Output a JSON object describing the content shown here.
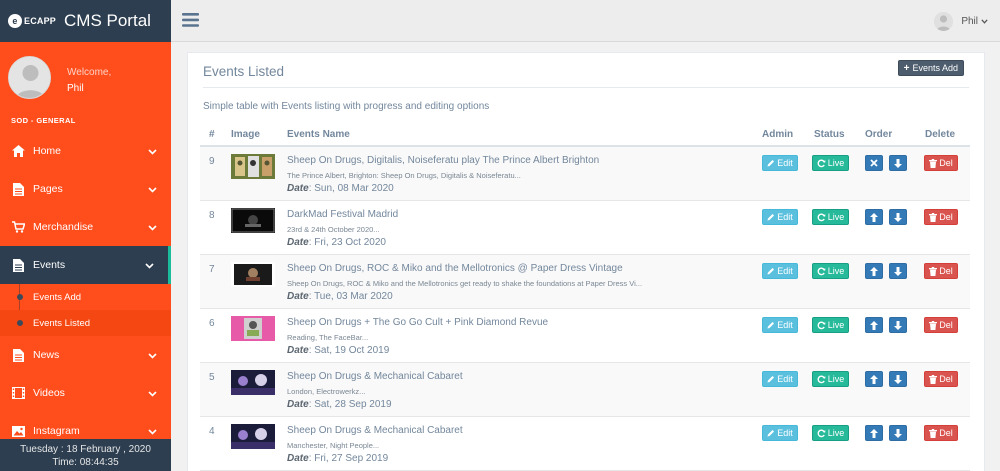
{
  "brand": {
    "logo_text": "ECAPP",
    "logo_letter": "e",
    "title": "CMS Portal"
  },
  "profile": {
    "welcome": "Welcome,",
    "name": "Phil"
  },
  "sidebar": {
    "section_label": "SOD - GENERAL",
    "items": [
      {
        "label": "Home",
        "icon": "home-icon"
      },
      {
        "label": "Pages",
        "icon": "file-icon"
      },
      {
        "label": "Merchandise",
        "icon": "cart-icon"
      },
      {
        "label": "Events",
        "icon": "file-icon",
        "active": true
      },
      {
        "label": "News",
        "icon": "file-icon"
      },
      {
        "label": "Videos",
        "icon": "film-icon"
      },
      {
        "label": "Instagram",
        "icon": "image-icon"
      }
    ],
    "events_submenu": [
      {
        "label": "Events Add"
      },
      {
        "label": "Events Listed",
        "selected": true
      }
    ]
  },
  "footer": {
    "date_line": "Tuesday : 18 February , 2020",
    "time_line": "Time: 08:44:35"
  },
  "topbar": {
    "user_name": "Phil"
  },
  "panel": {
    "title": "Events Listed",
    "add_button": "Events Add",
    "description": "Simple table with Events listing with progress and editing options"
  },
  "table": {
    "headers": {
      "num": "#",
      "image": "Image",
      "name": "Events Name",
      "admin": "Admin",
      "status": "Status",
      "order": "Order",
      "delete": "Delete"
    },
    "actions": {
      "edit": "Edit",
      "live": "Live",
      "del": "Del",
      "date_label": "Date"
    },
    "rows": [
      {
        "num": "9",
        "name": "Sheep On Drugs, Digitalis, Noiseferatu play The Prince Albert Brighton",
        "desc": "The Prince Albert, Brighton: Sheep On Drugs, Digitalis & Noiseferatu...",
        "date": ": Sun, 08 Mar 2020",
        "first": true
      },
      {
        "num": "8",
        "name": "DarkMad Festival Madrid",
        "desc": "23rd & 24th October 2020...",
        "date": ": Fri, 23 Oct 2020"
      },
      {
        "num": "7",
        "name": "Sheep On Drugs, ROC & Miko and the Mellotronics @ Paper Dress Vintage",
        "desc": "Sheep On Drugs, ROC & Miko and the Mellotronics get ready to shake the foundations at Paper Dress Vi...",
        "date": ": Tue, 03 Mar 2020"
      },
      {
        "num": "6",
        "name": "Sheep On Drugs + The Go Go Cult + Pink Diamond Revue",
        "desc": "Reading, The FaceBar...",
        "date": ": Sat, 19 Oct 2019"
      },
      {
        "num": "5",
        "name": "Sheep On Drugs & Mechanical Cabaret",
        "desc": "London, Electrowerkz...",
        "date": ": Sat, 28 Sep 2019"
      },
      {
        "num": "4",
        "name": "Sheep On Drugs & Mechanical Cabaret",
        "desc": "Manchester, Night People...",
        "date": ": Fri, 27 Sep 2019"
      }
    ]
  }
}
